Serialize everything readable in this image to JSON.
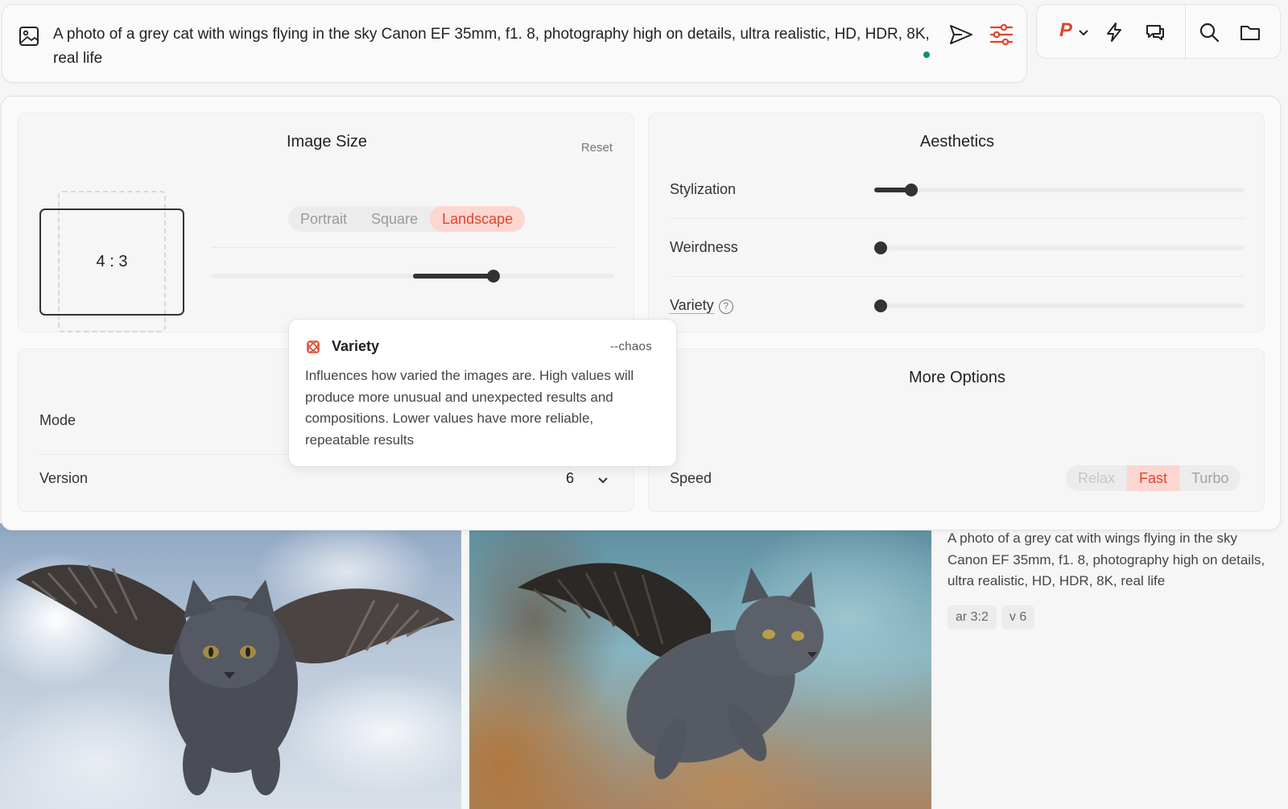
{
  "prompt": {
    "text": "A photo of a grey cat with wings flying in the sky Canon EF 35mm, f1. 8, photography high on details, ultra realistic, HD, HDR, 8K, real life"
  },
  "toolbar": {
    "profile_letter": "P"
  },
  "image_size": {
    "title": "Image Size",
    "reset": "Reset",
    "ratio": "4 : 3",
    "orientations": [
      "Portrait",
      "Square",
      "Landscape"
    ],
    "selected": "Landscape",
    "slider_value": 0.65
  },
  "aesthetics": {
    "title": "Aesthetics",
    "stylization": {
      "label": "Stylization",
      "value": 0.1
    },
    "weirdness": {
      "label": "Weirdness",
      "value": 0.0
    },
    "variety": {
      "label": "Variety",
      "value": 0.0,
      "help": "?"
    }
  },
  "model": {
    "mode_label": "Mode",
    "version_label": "Version",
    "version_value": "6"
  },
  "more_options": {
    "title": "More Options",
    "speed_label": "Speed",
    "speeds": [
      "Relax",
      "Fast",
      "Turbo"
    ],
    "selected": "Fast"
  },
  "tooltip": {
    "title": "Variety",
    "flag": "--chaos",
    "body": "Influences how varied the images are. High values will produce more unusual and unexpected results and compositions. Lower values have more reliable, repeatable results"
  },
  "result": {
    "caption": "A photo of a grey cat with wings flying in the sky Canon EF 35mm, f1. 8, photography high on details, ultra realistic, HD, HDR, 8K, real life",
    "tags": [
      "ar 3:2",
      "v 6"
    ]
  },
  "colors": {
    "accent": "#e1442d",
    "accent_bg": "#fcd6d0",
    "status_dot": "#0c9270"
  }
}
